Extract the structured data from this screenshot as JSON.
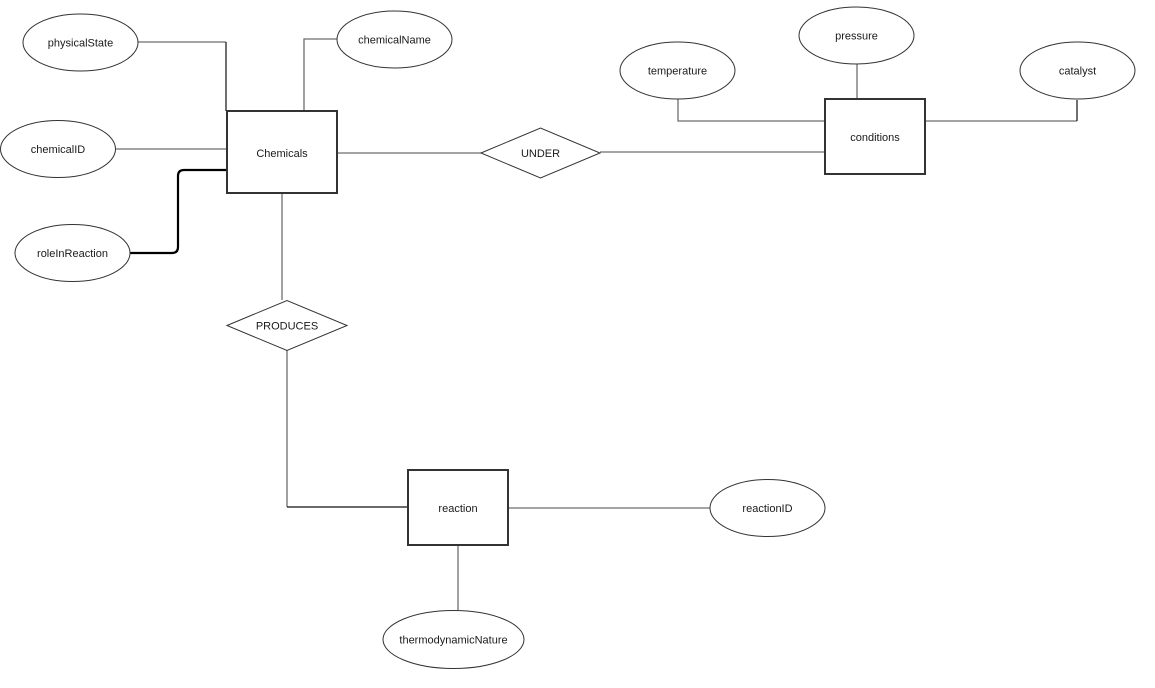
{
  "diagram": {
    "type": "entity-relationship",
    "entities": [
      {
        "id": "chemicals",
        "label": "Chemicals"
      },
      {
        "id": "conditions",
        "label": "conditions"
      },
      {
        "id": "reaction",
        "label": "reaction"
      }
    ],
    "relationships": [
      {
        "id": "under",
        "label": "UNDER",
        "connects": [
          "chemicals",
          "conditions"
        ]
      },
      {
        "id": "produces",
        "label": "PRODUCES",
        "connects": [
          "chemicals",
          "reaction"
        ]
      }
    ],
    "attributes": [
      {
        "id": "physicalState",
        "label": "physicalState",
        "entity": "chemicals"
      },
      {
        "id": "chemicalName",
        "label": "chemicalName",
        "entity": "chemicals"
      },
      {
        "id": "chemicalID",
        "label": "chemicalID",
        "entity": "chemicals"
      },
      {
        "id": "roleInReaction",
        "label": "roleInReaction",
        "entity": "chemicals"
      },
      {
        "id": "temperature",
        "label": "temperature",
        "entity": "conditions"
      },
      {
        "id": "pressure",
        "label": "pressure",
        "entity": "conditions"
      },
      {
        "id": "catalyst",
        "label": "catalyst",
        "entity": "conditions"
      },
      {
        "id": "reactionID",
        "label": "reactionID",
        "entity": "reaction"
      },
      {
        "id": "thermodynamicNature",
        "label": "thermodynamicNature",
        "entity": "reaction"
      }
    ]
  }
}
